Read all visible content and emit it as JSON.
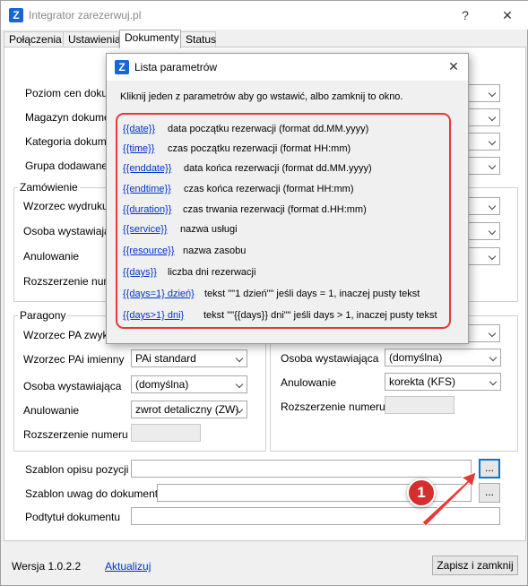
{
  "window": {
    "title": "Integrator zarezerwuj.pl",
    "help_label": "?",
    "close_label": "✕",
    "logo_letter": "Z"
  },
  "tabs": [
    "Połączenia",
    "Ustawienia",
    "Dokumenty",
    "Status"
  ],
  "active_tab": "Dokumenty",
  "top_section": {
    "fields": [
      "Poziom cen dokum",
      "Magazyn dokument",
      "Kategoria dokumen",
      "Grupa dodawanego"
    ]
  },
  "zamowienie": {
    "title": "Zamówienie",
    "fields": [
      "Wzorzec wydruku",
      "Osoba wystawiająca",
      "Anulowanie",
      "Rozszerzenie numeru"
    ]
  },
  "paragony": {
    "title": "Paragony",
    "left": [
      {
        "label": "Wzorzec PA zwykły",
        "value": ""
      },
      {
        "label": "Wzorzec PAi imienny",
        "value": "PAi standard"
      },
      {
        "label": "Osoba wystawiająca",
        "value": "(domyślna)"
      },
      {
        "label": "Anulowanie",
        "value": "zwrot detaliczny (ZW)"
      },
      {
        "label": "Rozszerzenie numeru",
        "value": ""
      }
    ],
    "right": [
      {
        "label": "Osoba wystawiająca",
        "value": "(domyślna)"
      },
      {
        "label": "Anulowanie",
        "value": "korekta (KFS)"
      },
      {
        "label": "Rozszerzenie numeru",
        "value": ""
      }
    ]
  },
  "bottom_fields": {
    "szablon_opisu": "Szablon opisu pozycji",
    "szablon_uwag": "Szablon uwag do dokumentu",
    "podtytul": "Podtytuł dokumentu",
    "browse_label": "..."
  },
  "footer": {
    "version": "Wersja 1.0.2.2",
    "update_link": "Aktualizuj",
    "save_button": "Zapisz i zamknij"
  },
  "dialog": {
    "title": "Lista parametrów",
    "instruction": "Kliknij jeden z parametrów aby go wstawić, albo zamknij to okno.",
    "params": [
      {
        "name": "{{date}}",
        "desc": "data początku rezerwacji (format dd.MM.yyyy)"
      },
      {
        "name": "{{time}}",
        "desc": "czas początku rezerwacji (format HH:mm)"
      },
      {
        "name": "{{enddate}}",
        "desc": "data końca rezerwacji (format dd.MM.yyyy)"
      },
      {
        "name": "{{endtime}}",
        "desc": "czas końca rezerwacji (format HH:mm)"
      },
      {
        "name": "{{duration}}",
        "desc": "czas trwania rezerwacji (format d.HH:mm)"
      },
      {
        "name": "{{service}}",
        "desc": "nazwa usługi"
      },
      {
        "name": "{{resource}}",
        "desc": "nazwa zasobu"
      },
      {
        "name": "{{days}}",
        "desc": "liczba dni rezerwacji"
      },
      {
        "name": "{{days=1} dzień}",
        "desc": "tekst \"\"1 dzień\"\" jeśli days = 1, inaczej pusty tekst"
      },
      {
        "name": "{{days>1} dni}",
        "desc": "tekst \"\"{{days}} dni\"\" jeśli days > 1, inaczej pusty tekst"
      }
    ]
  },
  "callout": {
    "number": "1"
  },
  "colors": {
    "accent": "#1766d6",
    "highlight": "#e53935",
    "link": "#0033cc"
  }
}
